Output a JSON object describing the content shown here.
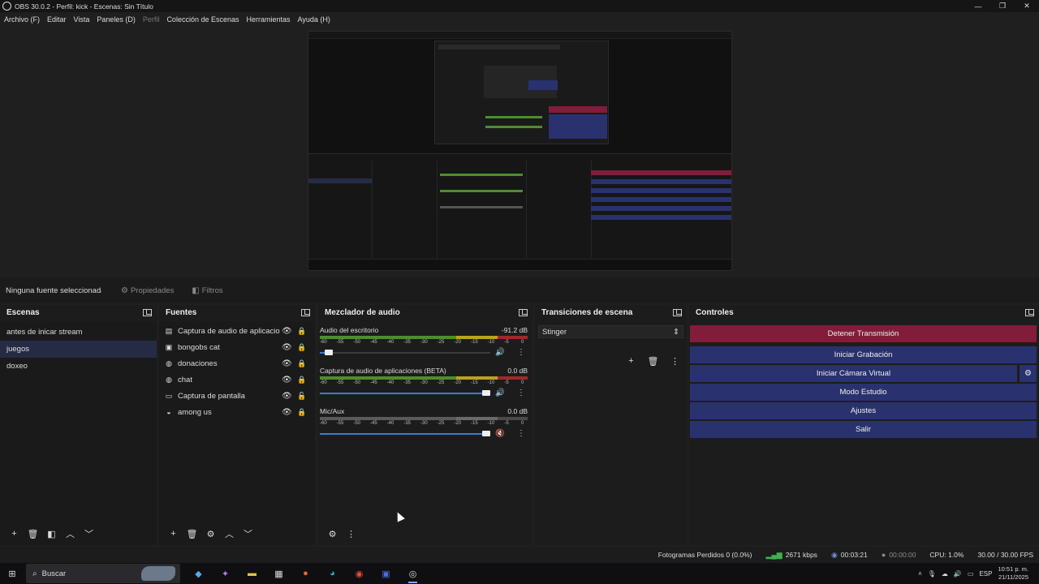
{
  "window": {
    "title": "OBS 30.0.2 - Perfil: kick - Escenas: Sin Título",
    "controls": [
      "—",
      "❐",
      "✕"
    ]
  },
  "menu": [
    "Archivo (F)",
    "Editar",
    "Vista",
    "Paneles (D)",
    "Perfil",
    "Colección de Escenas",
    "Herramientas",
    "Ayuda (H)"
  ],
  "propbar": {
    "no_source": "Ninguna fuente seleccionada",
    "properties": "Propiedades",
    "filters": "Filtros"
  },
  "scenes": {
    "title": "Escenas",
    "items": [
      {
        "label": "antes de inicar stream",
        "selected": false
      },
      {
        "label": "juegos",
        "selected": true
      },
      {
        "label": "doxeo",
        "selected": false
      }
    ]
  },
  "sources": {
    "title": "Fuentes",
    "items": [
      {
        "label": "Captura de audio de aplicaciones",
        "icon": "app-audio-capture-icon",
        "locked": true
      },
      {
        "label": "bongobs cat",
        "icon": "browser-source-icon",
        "locked": true
      },
      {
        "label": "donaciones",
        "icon": "globe-icon",
        "locked": true
      },
      {
        "label": "chat",
        "icon": "globe-icon",
        "locked": true
      },
      {
        "label": "Captura de pantalla",
        "icon": "monitor-icon",
        "locked": false
      },
      {
        "label": "among us",
        "icon": "game-capture-icon",
        "locked": true
      }
    ]
  },
  "mixer": {
    "title": "Mezclador de audio",
    "channels": [
      {
        "name": "Audio del escritorio",
        "db": "-91.2 dB",
        "volume": 0.05,
        "muted": false
      },
      {
        "name": "Captura de audio de aplicaciones (BETA)",
        "db": "0.0 dB",
        "volume": 1.0,
        "muted": false
      },
      {
        "name": "Mic/Aux",
        "db": "0.0 dB",
        "volume": 1.0,
        "muted": true
      }
    ],
    "ticks": [
      "-60",
      "-55",
      "-50",
      "-45",
      "-40",
      "-35",
      "-30",
      "-25",
      "-20",
      "-15",
      "-10",
      "-5",
      "0"
    ]
  },
  "transitions": {
    "title": "Transiciones de escena",
    "selected": "Stinger"
  },
  "controls": {
    "title": "Controles",
    "stop_stream": "Detener Transmisión",
    "start_recording": "Iniciar Grabación",
    "start_virtual_cam": "Iniciar Cámara Virtual",
    "studio_mode": "Modo Estudio",
    "settings": "Ajustes",
    "exit": "Salir"
  },
  "status": {
    "dropped_frames": "Fotogramas Perdidos 0 (0.0%)",
    "bitrate": "2671 kbps",
    "stream_time": "00:03:21",
    "record_time": "00:00:00",
    "cpu": "CPU: 1.0%",
    "fps": "30.00 / 30.00 FPS"
  },
  "taskbar": {
    "search_placeholder": "Buscar",
    "lang": "ESP",
    "time": "10:51 p. m.",
    "date": "21/11/2025"
  },
  "colors": {
    "stop_button": "#811d3a",
    "control_button": "#29326e",
    "selected_scene": "#262b45",
    "slider": "#3c7bd6"
  }
}
